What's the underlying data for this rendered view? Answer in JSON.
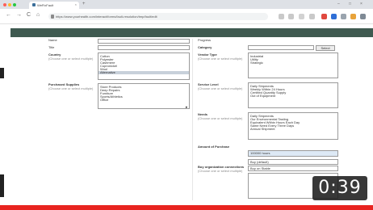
{
  "browser": {
    "tab_title": "WeFixFault",
    "tab_close": "×",
    "new_tab": "+",
    "url": "https://www.yourhealth.com/interact/forms/fault-resolution/tmp/fault/edit",
    "nav": {
      "back": "←",
      "forward": "→",
      "reload": "C",
      "home": "⌂"
    },
    "window": {
      "minimize": "–",
      "maximize": "□",
      "close": "×"
    },
    "colors": {
      "red": "#ff5f57",
      "yellow": "#febc2e",
      "green": "#28c840"
    }
  },
  "form": {
    "left": {
      "field_1": {
        "label": "Name",
        "value": ""
      },
      "field_2": {
        "label": "Title",
        "value": ""
      },
      "field_3": {
        "label": "Country",
        "hint": "(Choose one or select multiple)",
        "options": [
          "Cotton",
          "Polyester",
          "Cashmere",
          "Cupronickel",
          "Wool",
          "Alternative"
        ],
        "selected": 5
      },
      "field_4": {
        "label": "Purchased Supplies",
        "hint": "(Choose one or select multiple)",
        "options": [
          "Store Products",
          "Deep Repairs",
          "Furniture",
          "Sports/Athletics",
          "Office"
        ]
      }
    },
    "right": {
      "status": {
        "label": "Progress",
        "value": ""
      },
      "category": {
        "label": "Category",
        "value": "",
        "button": "Select"
      },
      "vendor_type": {
        "label": "Vendor Type",
        "hint": "(Choose one or select multiple)",
        "options": [
          "Industrial",
          "Utility",
          "Strategic"
        ]
      },
      "service_level": {
        "label": "Service Level",
        "hint": "(Choose one or select multiple)",
        "options": [
          "Daily Shipments",
          "Weekly Within 24 Hours",
          "Certified Quantity Supply",
          "Out of Equipment"
        ]
      },
      "needs": {
        "label": "Needs",
        "hint": "(Choose one or select multiple)",
        "options": [
          "Daily Shipments",
          "Our Environmental Tasting",
          "Equivalent Within Hours Each Day",
          "Same Need Every Three Days",
          "Annual Shipment"
        ]
      },
      "total": {
        "label": "Amount of Purchase",
        "value": "100000 hours"
      },
      "org": {
        "label": "Buy organization connections",
        "hint": "(Choose one or select multiple)",
        "select_1": "Buy (default)",
        "select_2": "Buy on Stable"
      }
    }
  },
  "video": {
    "timestamp": "0:39"
  }
}
